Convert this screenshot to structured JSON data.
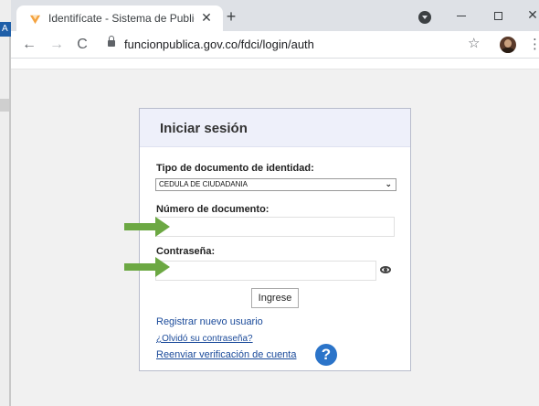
{
  "tab": {
    "title": "Identifícate - Sistema de Publicac",
    "close_glyph": "✕",
    "new_tab_glyph": "+"
  },
  "window": {
    "close_glyph": "✕"
  },
  "toolbar": {
    "back_glyph": "←",
    "forward_glyph": "→",
    "reload_glyph": "C",
    "url": "funcionpublica.gov.co/fdci/login/auth",
    "star_glyph": "☆",
    "menu_glyph": "⋮"
  },
  "underlying_window": {
    "letter": "A"
  },
  "login": {
    "title": "Iniciar sesión",
    "doc_type_label": "Tipo de documento de identidad:",
    "doc_type_value": "CEDULA DE CIUDADANIA",
    "doc_type_chevron": "⌄",
    "doc_number_label": "Número de documento:",
    "doc_number_value": "",
    "password_label": "Contraseña:",
    "password_value": "",
    "submit_label": "Ingrese",
    "register_link": "Registrar nuevo usuario",
    "forgot_link": "¿Olvidó su contraseña?",
    "resend_link": "Reenviar verificación de cuenta",
    "help_glyph": "?"
  },
  "colors": {
    "annotation_arrow": "#6ca843",
    "link": "#1a4a9a",
    "help_icon": "#2b74c9",
    "favicon": "#f4a340"
  },
  "icons": [
    "favicon-icon",
    "new-tab-icon",
    "profile-icon",
    "back-icon",
    "forward-icon",
    "reload-icon",
    "lock-icon",
    "star-icon",
    "avatar-icon",
    "menu-icon",
    "eye-icon",
    "help-icon",
    "arrow-icon"
  ]
}
